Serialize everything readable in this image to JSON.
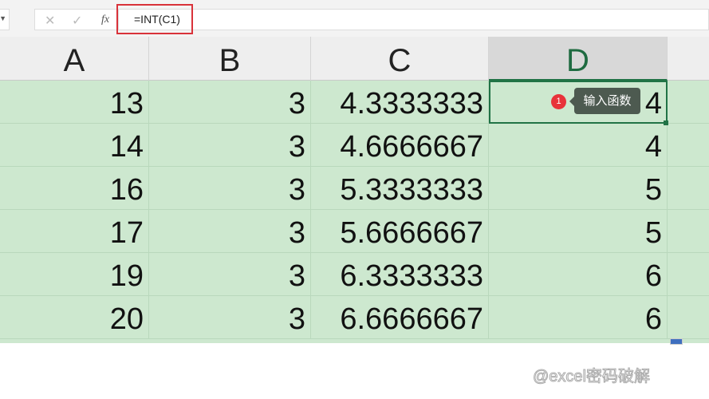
{
  "formula_bar": {
    "cancel_icon": "✕",
    "enter_icon": "✓",
    "fx_label": "fx",
    "formula": "=INT(C1)"
  },
  "columns": [
    "A",
    "B",
    "C",
    "D"
  ],
  "rows": [
    [
      "13",
      "3",
      "4.3333333",
      "4"
    ],
    [
      "14",
      "3",
      "4.6666667",
      "4"
    ],
    [
      "16",
      "3",
      "5.3333333",
      "5"
    ],
    [
      "17",
      "3",
      "5.6666667",
      "5"
    ],
    [
      "19",
      "3",
      "6.3333333",
      "6"
    ],
    [
      "20",
      "3",
      "6.6666667",
      "6"
    ]
  ],
  "annotation": {
    "step": "1",
    "text": "输入函数"
  },
  "watermark": "@excel密码破解",
  "colors": {
    "highlight": "#cde8cf",
    "selection": "#217346",
    "callout_red": "#d9323a"
  }
}
